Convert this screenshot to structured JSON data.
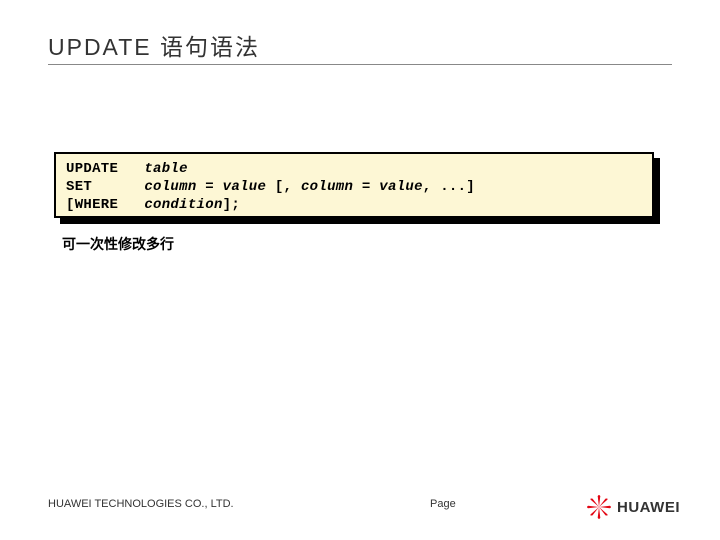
{
  "title": "UPDATE 语句语法",
  "code": {
    "line1_kw": "UPDATE",
    "line1_arg": "table",
    "line2_kw": "SET",
    "line2_arg_a": "column = value ",
    "line2_sep1": "[,",
    "line2_arg_b": " column = value",
    "line2_sep2": ", ...]",
    "line3_kw": "[WHERE",
    "line3_arg": "condition",
    "line3_end": "];"
  },
  "note": "可一次性修改多行",
  "footer": {
    "company": "HUAWEI TECHNOLOGIES CO., LTD.",
    "page_label": "Page",
    "brand": "HUAWEI"
  }
}
